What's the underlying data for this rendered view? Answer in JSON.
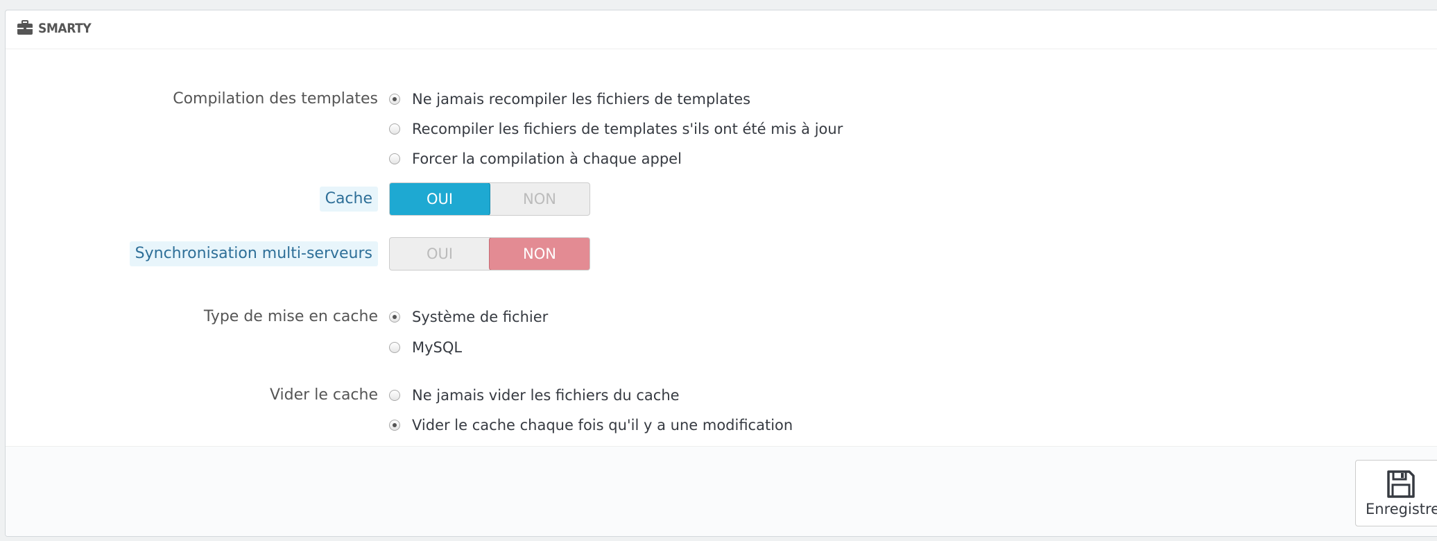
{
  "panel": {
    "title": "SMARTY",
    "icon": "briefcase-icon"
  },
  "compilation": {
    "label": "Compilation des templates",
    "options": [
      {
        "label": "Ne jamais recompiler les fichiers de templates",
        "checked": true
      },
      {
        "label": "Recompiler les fichiers de templates s'ils ont été mis à jour",
        "checked": false
      },
      {
        "label": "Forcer la compilation à chaque appel",
        "checked": false
      }
    ]
  },
  "cache": {
    "label": "Cache",
    "yes": "OUI",
    "no": "NON",
    "value": "OUI"
  },
  "sync": {
    "label": "Synchronisation multi-serveurs",
    "yes": "OUI",
    "no": "NON",
    "value": "NON"
  },
  "cache_type": {
    "label": "Type de mise en cache",
    "options": [
      {
        "label": "Système de fichier",
        "checked": true
      },
      {
        "label": "MySQL",
        "checked": false
      }
    ]
  },
  "clear_cache": {
    "label": "Vider le cache",
    "options": [
      {
        "label": "Ne jamais vider les fichiers du cache",
        "checked": false
      },
      {
        "label": "Vider le cache chaque fois qu'il y a une modification",
        "checked": true
      }
    ]
  },
  "footer": {
    "save_label": "Enregistrer",
    "save_icon": "floppy-disk-icon"
  },
  "colors": {
    "accent_blue": "#1ea9d2",
    "accent_red": "#e38b93",
    "help_label": "#2e6f98"
  }
}
